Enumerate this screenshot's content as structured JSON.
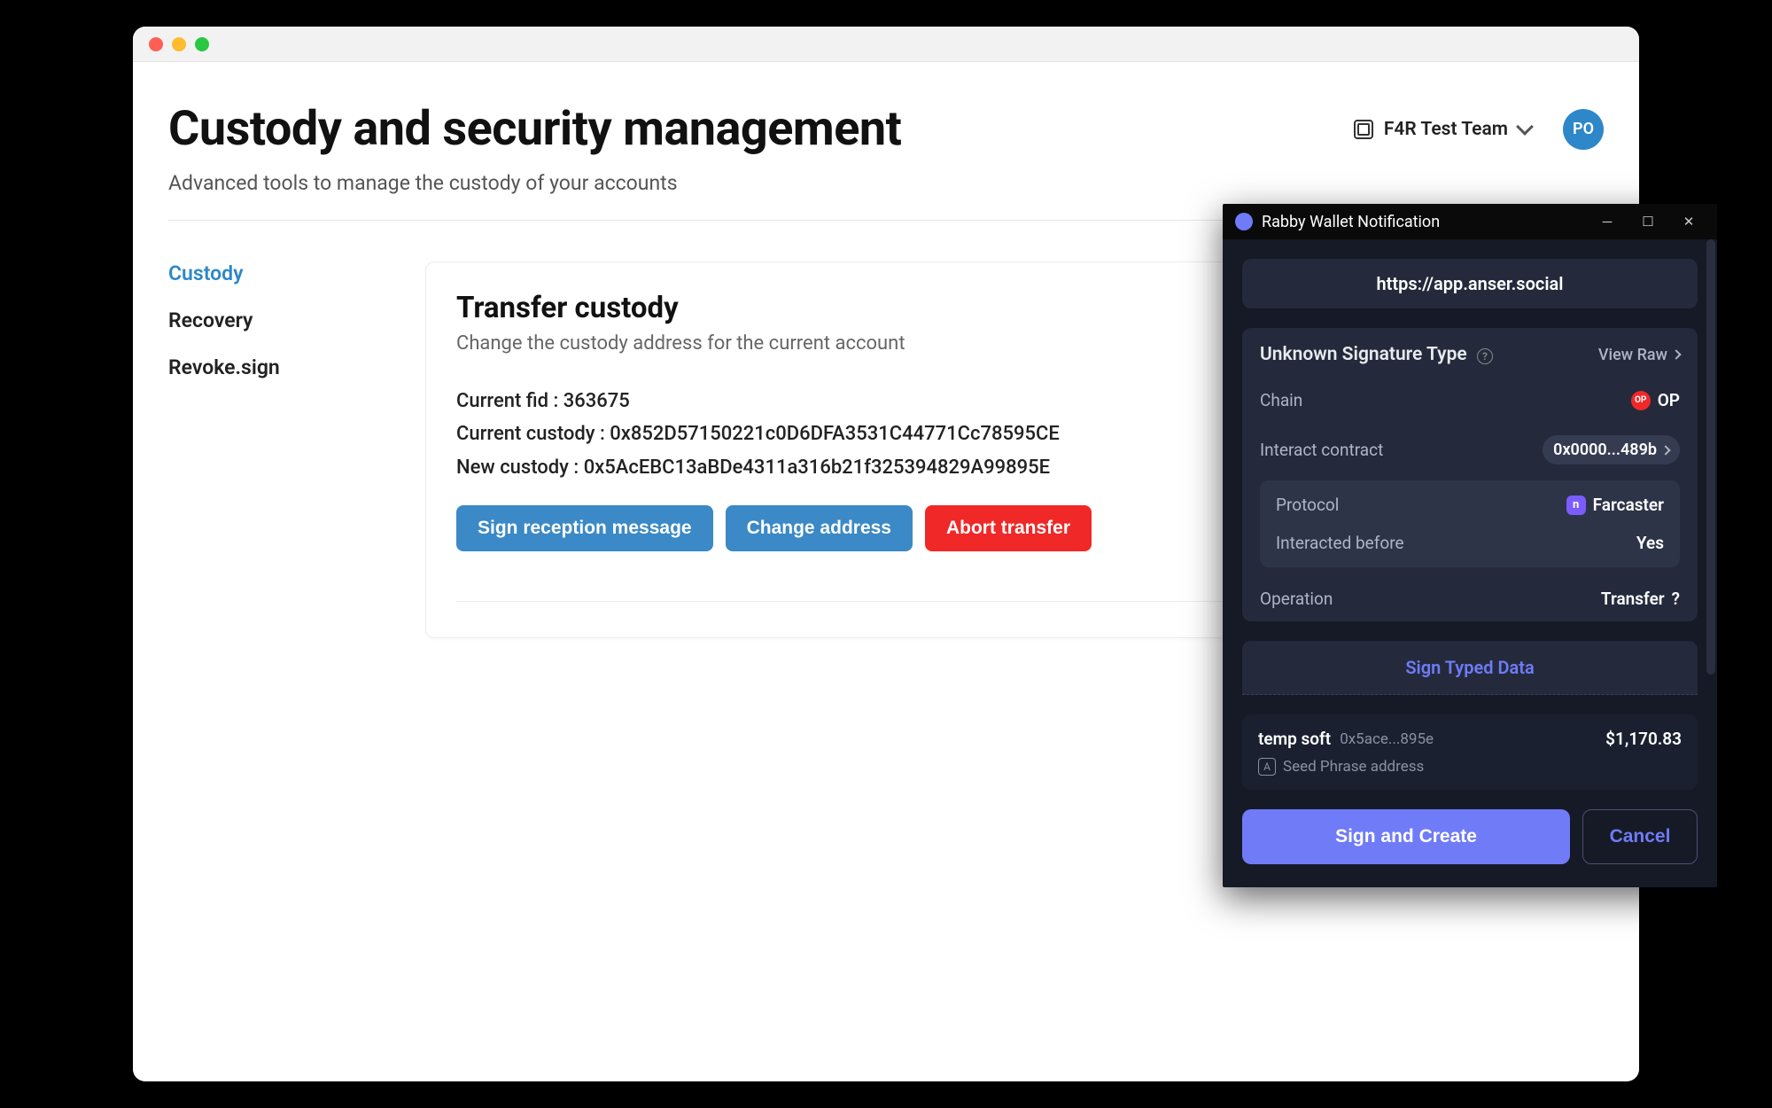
{
  "page": {
    "title": "Custody and security management",
    "subtitle": "Advanced tools to manage the custody of your accounts"
  },
  "team": {
    "name": "F4R Test Team",
    "avatar_initials": "PO"
  },
  "sidebar": {
    "items": [
      {
        "label": "Custody",
        "active": true
      },
      {
        "label": "Recovery",
        "active": false
      },
      {
        "label": "Revoke.sign",
        "active": false
      }
    ]
  },
  "card": {
    "title": "Transfer custody",
    "subtitle": "Change the custody address for the current account",
    "fid_label": "Current fid :",
    "fid_value": "363675",
    "current_custody_label": "Current custody :",
    "current_custody_value": "0x852D57150221c0D6DFA3531C44771Cc78595CE",
    "new_custody_label": "New custody :",
    "new_custody_value": "0x5AcEBC13aBDe4311a316b21f325394829A99895E",
    "buttons": {
      "sign": "Sign reception message",
      "change": "Change address",
      "abort": "Abort transfer"
    }
  },
  "rabby": {
    "window_title": "Rabby Wallet Notification",
    "url": "https://app.anser.social",
    "sig_type": "Unknown Signature Type",
    "view_raw": "View Raw",
    "chain": {
      "label": "Chain",
      "badge": "OP",
      "name": "OP"
    },
    "contract": {
      "label": "Interact contract",
      "value": "0x0000...489b"
    },
    "protocol": {
      "label": "Protocol",
      "value": "Farcaster"
    },
    "interacted": {
      "label": "Interacted before",
      "value": "Yes"
    },
    "operation": {
      "label": "Operation",
      "value": "Transfer"
    },
    "sign_typed": "Sign Typed Data",
    "account": {
      "name": "temp soft",
      "address": "0x5ace...895e",
      "balance": "$1,170.83",
      "type": "Seed Phrase address"
    },
    "actions": {
      "primary": "Sign and Create",
      "secondary": "Cancel"
    }
  }
}
